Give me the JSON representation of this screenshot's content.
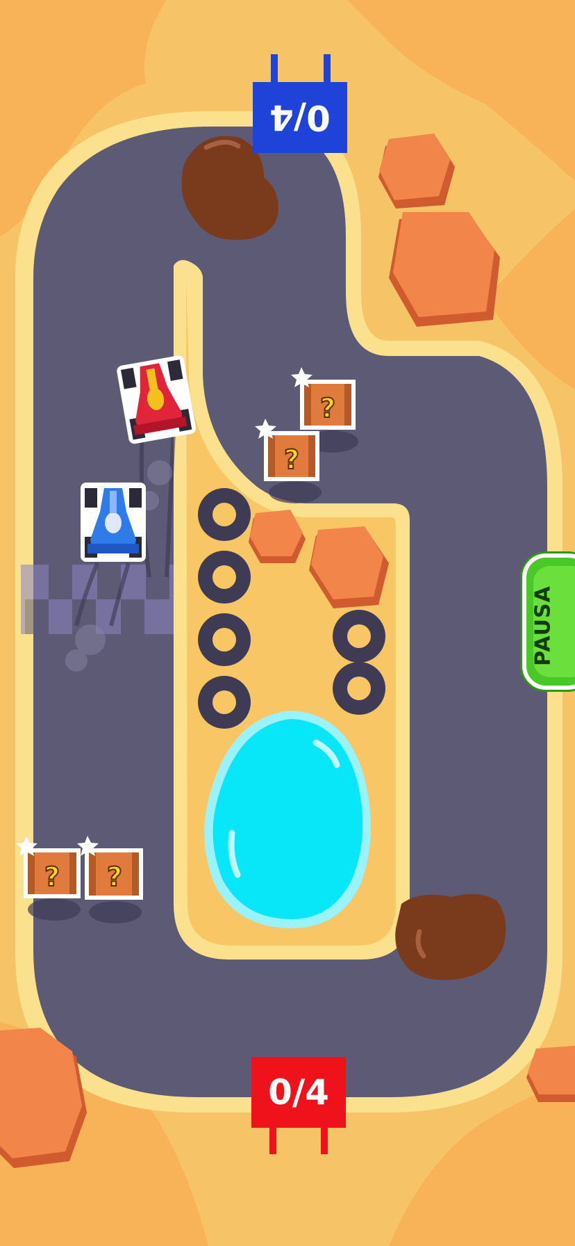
{
  "scoreboard": {
    "blue_score": "0/4",
    "red_score": "0/4"
  },
  "controls": {
    "pause_label": "PAUSA"
  },
  "colors": {
    "sand": "#f6c467",
    "track": "#5d5a76",
    "water": "#07e7f8",
    "blue_team": "#1f43d8",
    "red_team": "#f0121a",
    "pause_green": "#49c928"
  },
  "icons": [
    "mystery-box-icon",
    "tire-stack-icon",
    "rock-icon",
    "boulder-icon",
    "race-car-icon",
    "finish-line-icon",
    "water-pond-icon"
  ]
}
